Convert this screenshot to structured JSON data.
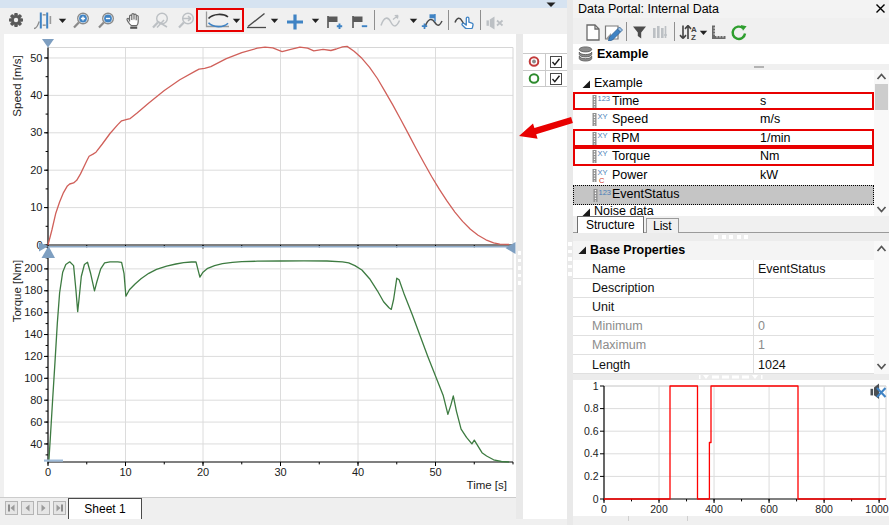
{
  "colors": {
    "annotation_red": "#e80000",
    "speed_curve": "#d0605a",
    "torque_curve": "#3d7b41",
    "event_curve": "#ff0000",
    "cursor_blue": "#7e9fc1",
    "grid": "#dcdcdc",
    "selection_gray": "#c5c5c5",
    "menu_sliver_blue": "#d6e3f1"
  },
  "view_toolbar": {
    "icons": [
      {
        "name": "settings-gear-icon"
      },
      {
        "name": "cursor-config-icon",
        "dropdown": true
      },
      {
        "name": "zoom-in-icon"
      },
      {
        "name": "zoom-out-icon"
      },
      {
        "name": "pan-hand-icon"
      },
      {
        "name": "zoom-off-icon",
        "disabled": true
      },
      {
        "name": "zoom-previous-icon",
        "disabled": true
      },
      {
        "name": "band-cursor-icon",
        "dropdown": true,
        "highlighted": true
      },
      {
        "name": "slope-cursor-icon",
        "dropdown": true
      },
      {
        "name": "crosshair-cursor-icon",
        "dropdown": true
      },
      {
        "name": "add-flag-icon"
      },
      {
        "name": "remove-flag-icon"
      },
      {
        "name": "curve-transform-icon",
        "disabled": true,
        "dropdown": true
      },
      {
        "name": "flag-data-points-icon"
      },
      {
        "name": "select-curve-icon"
      },
      {
        "name": "audio-replay-icon",
        "disabled": true
      }
    ]
  },
  "legend": {
    "items": [
      {
        "symbol": "red-filled-circle",
        "checked": true
      },
      {
        "symbol": "green-circle",
        "checked": true
      }
    ]
  },
  "sheet_bar": {
    "active_tab": "Sheet 1"
  },
  "portal": {
    "title": "Data Portal: Internal Data",
    "toolbar_icons": [
      {
        "name": "new-data-icon"
      },
      {
        "name": "register-data-icon"
      },
      {
        "name": "filter-icon"
      },
      {
        "name": "channel-edit-icon",
        "disabled": true
      },
      {
        "name": "sort-az-icon",
        "dropdown": true
      },
      {
        "name": "scale-icon"
      },
      {
        "name": "refresh-icon"
      }
    ],
    "root_label": "Example",
    "tree": [
      {
        "type": "group",
        "label": "Example",
        "expanded": true
      },
      {
        "type": "num",
        "label": "Time",
        "unit": "s",
        "redbox": true
      },
      {
        "type": "xy",
        "label": "Speed",
        "unit": "m/s"
      },
      {
        "type": "xy",
        "label": "RPM",
        "unit": "1/min",
        "redbox": true
      },
      {
        "type": "xy",
        "label": "Torque",
        "unit": "Nm",
        "redbox": true
      },
      {
        "type": "xyc",
        "label": "Power",
        "unit": "kW"
      },
      {
        "type": "num",
        "label": "EventStatus",
        "unit": "",
        "selected": true
      },
      {
        "type": "group",
        "label": "Noise data",
        "expanded": true,
        "partial": true
      }
    ],
    "tabs": [
      "Structure",
      "List"
    ],
    "properties": {
      "title": "Base Properties",
      "rows": [
        {
          "key": "Name",
          "value": "EventStatus"
        },
        {
          "key": "Description",
          "value": ""
        },
        {
          "key": "Unit",
          "value": ""
        },
        {
          "key": "Minimum",
          "value": "0",
          "gray": true
        },
        {
          "key": "Maximum",
          "value": "1",
          "gray": true
        },
        {
          "key": "Length",
          "value": "1024"
        }
      ]
    }
  },
  "chart_data": [
    {
      "id": "speed",
      "type": "line",
      "title": "",
      "xlabel": "Time [s]",
      "ylabel": "Speed [m/s]",
      "xlim": [
        0,
        60
      ],
      "ylim": [
        0,
        52.8
      ],
      "y_ticks": [
        0,
        10,
        20,
        30,
        40,
        50
      ],
      "y_minor_step": 5,
      "x_ticks": [
        0,
        10,
        20,
        30,
        40,
        50
      ],
      "x_minor_step": 5,
      "grid": true,
      "series": [
        {
          "name": "Speed",
          "color": "#d0605a",
          "points": [
            [
              0,
              0
            ],
            [
              0.5,
              4
            ],
            [
              1,
              8.5
            ],
            [
              1.5,
              11.5
            ],
            [
              2,
              14
            ],
            [
              2.5,
              15.8
            ],
            [
              2.8,
              16.3
            ],
            [
              3.3,
              16.6
            ],
            [
              3.7,
              17.3
            ],
            [
              4.2,
              19
            ],
            [
              5,
              22.5
            ],
            [
              5.3,
              23.7
            ],
            [
              5.8,
              24.3
            ],
            [
              6.2,
              24.8
            ],
            [
              7,
              27
            ],
            [
              8,
              29.8
            ],
            [
              9,
              32.2
            ],
            [
              9.5,
              33.2
            ],
            [
              10.2,
              33.6
            ],
            [
              10.6,
              33.8
            ],
            [
              11.5,
              35.3
            ],
            [
              13,
              38
            ],
            [
              15,
              41.3
            ],
            [
              17,
              44.2
            ],
            [
              19,
              46.5
            ],
            [
              19.5,
              47
            ],
            [
              20.2,
              47.2
            ],
            [
              21,
              47.7
            ],
            [
              23,
              49.8
            ],
            [
              25,
              51.4
            ],
            [
              27,
              52.6
            ],
            [
              28,
              52.9
            ],
            [
              29,
              52.7
            ],
            [
              30.2,
              51.7
            ],
            [
              31.2,
              52.2
            ],
            [
              32.5,
              52.9
            ],
            [
              33.5,
              52.6
            ],
            [
              34.3,
              51.9
            ],
            [
              35.5,
              52.3
            ],
            [
              36.5,
              52.0
            ],
            [
              37.2,
              52.4
            ],
            [
              38,
              53.0
            ],
            [
              38.6,
              53.1
            ],
            [
              39.5,
              51.8
            ],
            [
              40.5,
              49.9
            ],
            [
              41.5,
              47.5
            ],
            [
              42.5,
              44.5
            ],
            [
              43.5,
              41
            ],
            [
              44.5,
              37.4
            ],
            [
              45.5,
              33.6
            ],
            [
              46.5,
              29.7
            ],
            [
              47.5,
              25.8
            ],
            [
              48.5,
              22
            ],
            [
              49.5,
              18.3
            ],
            [
              50.5,
              14.9
            ],
            [
              51.5,
              11.7
            ],
            [
              52.5,
              8.8
            ],
            [
              53.5,
              6.3
            ],
            [
              54.5,
              4.2
            ],
            [
              55.5,
              2.6
            ],
            [
              56.5,
              1.4
            ],
            [
              57.5,
              0.6
            ],
            [
              58.3,
              0.25
            ],
            [
              59.5,
              0.15
            ]
          ]
        }
      ]
    },
    {
      "id": "torque",
      "type": "line",
      "title": "",
      "xlabel": "Time [s]",
      "ylabel": "Torque [Nm]",
      "xlim": [
        0,
        60
      ],
      "ylim": [
        23.5,
        220
      ],
      "y_ticks": [
        40,
        60,
        80,
        100,
        120,
        140,
        160,
        180,
        200
      ],
      "y_minor_step": 10,
      "x_ticks": [
        0,
        10,
        20,
        30,
        40,
        50
      ],
      "x_minor_step": 5,
      "grid": true,
      "series": [
        {
          "name": "Torque",
          "color": "#3d7b41",
          "points": [
            [
              0.1,
              24
            ],
            [
              0.3,
              45
            ],
            [
              0.6,
              80
            ],
            [
              0.9,
              115
            ],
            [
              1.2,
              150
            ],
            [
              1.5,
              178
            ],
            [
              1.9,
              197
            ],
            [
              2.3,
              204
            ],
            [
              2.8,
              206.5
            ],
            [
              3.3,
              203
            ],
            [
              3.6,
              181
            ],
            [
              3.83,
              161
            ],
            [
              4.0,
              172
            ],
            [
              4.3,
              193
            ],
            [
              4.7,
              204
            ],
            [
              5.1,
              206
            ],
            [
              5.5,
              196
            ],
            [
              6.0,
              180
            ],
            [
              6.3,
              188
            ],
            [
              6.8,
              200
            ],
            [
              7.3,
              205.5
            ],
            [
              8,
              206.5
            ],
            [
              9,
              206.5
            ],
            [
              9.5,
              206
            ],
            [
              9.8,
              196
            ],
            [
              10.05,
              175
            ],
            [
              10.5,
              181
            ],
            [
              11.2,
              186
            ],
            [
              12,
              191
            ],
            [
              13,
              196
            ],
            [
              14,
              199.5
            ],
            [
              15.3,
              202.5
            ],
            [
              16.5,
              204.5
            ],
            [
              17.5,
              205.7
            ],
            [
              18.5,
              206.3
            ],
            [
              19.1,
              206.5
            ],
            [
              19.6,
              192.5
            ],
            [
              20.0,
              197
            ],
            [
              20.6,
              200.5
            ],
            [
              21.5,
              203
            ],
            [
              22.5,
              204.8
            ],
            [
              23.8,
              206
            ],
            [
              25,
              206.7
            ],
            [
              27,
              207
            ],
            [
              30,
              207.2
            ],
            [
              33,
              207.3
            ],
            [
              36,
              207.2
            ],
            [
              38,
              206.5
            ],
            [
              38.8,
              205.5
            ],
            [
              39.6,
              203
            ],
            [
              40.5,
              199
            ],
            [
              41.5,
              191
            ],
            [
              42.5,
              180
            ],
            [
              43.3,
              170
            ],
            [
              44.0,
              164.5
            ],
            [
              44.3,
              163
            ],
            [
              44.6,
              172
            ],
            [
              45.0,
              191.5
            ],
            [
              45.3,
              190
            ],
            [
              46,
              176
            ],
            [
              47,
              158
            ],
            [
              48,
              139
            ],
            [
              49,
              120
            ],
            [
              50,
              102
            ],
            [
              51,
              84
            ],
            [
              51.6,
              67
            ],
            [
              52.0,
              76
            ],
            [
              52.3,
              84
            ],
            [
              52.7,
              70
            ],
            [
              53.3,
              53.5
            ],
            [
              54,
              46
            ],
            [
              54.7,
              40
            ],
            [
              55.0,
              43.5
            ],
            [
              55.3,
              40
            ],
            [
              56,
              32
            ],
            [
              56.6,
              29
            ],
            [
              57.5,
              25.5
            ],
            [
              58.5,
              24
            ],
            [
              59.5,
              23.5
            ]
          ]
        }
      ]
    },
    {
      "id": "eventstatus_preview",
      "type": "line",
      "title": "",
      "xlabel": "",
      "ylabel": "",
      "xlim": [
        0,
        1025
      ],
      "ylim": [
        0,
        1
      ],
      "y_ticks": [
        0,
        0.2,
        0.4,
        0.6,
        0.8,
        1
      ],
      "x_ticks": [
        0,
        200,
        400,
        600,
        800,
        1000
      ],
      "x_minor_step": 100,
      "grid": true,
      "series": [
        {
          "name": "EventStatus",
          "color": "#ff0000",
          "points": [
            [
              0,
              0
            ],
            [
              240,
              0
            ],
            [
              240,
              1
            ],
            [
              340,
              1
            ],
            [
              340,
              0
            ],
            [
              383,
              0
            ],
            [
              383,
              0.5
            ],
            [
              389,
              0.5
            ],
            [
              389,
              1
            ],
            [
              705,
              1
            ],
            [
              705,
              0
            ],
            [
              1025,
              0
            ]
          ]
        }
      ]
    }
  ]
}
